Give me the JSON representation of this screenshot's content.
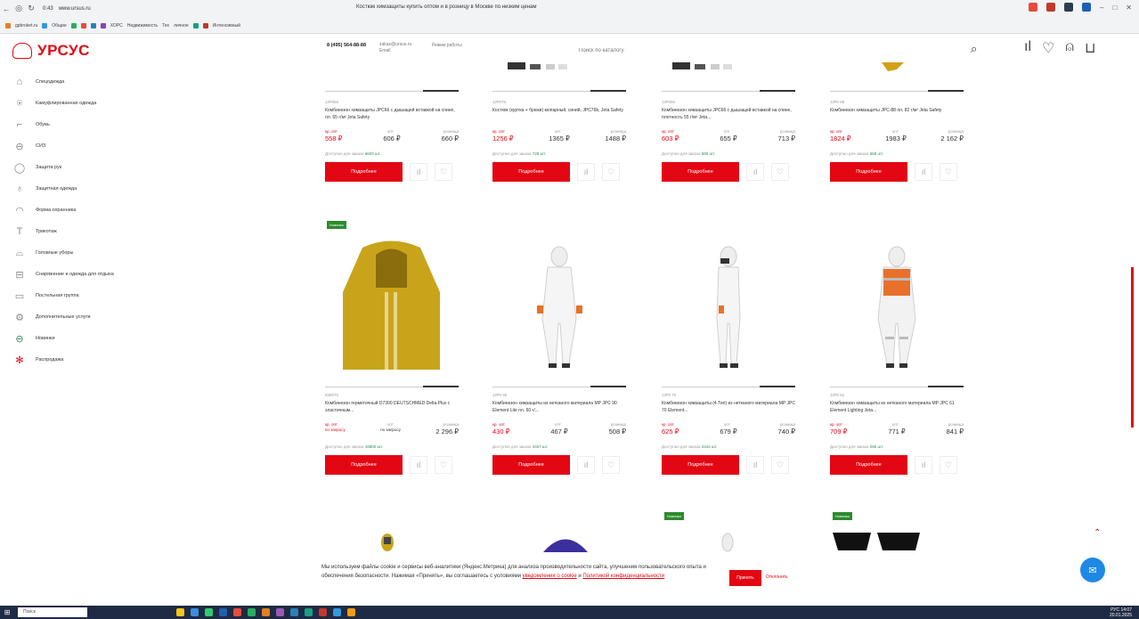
{
  "browser": {
    "url": "www.ursus.ru",
    "tab_count": "0:43",
    "page_title": "Костюм химзащиты купить оптом и в розницу в Москве по низким ценам",
    "bookmarks": [
      "gpbroket.ru",
      "Общие",
      "ХОРС",
      "Недвижимость",
      "Тех",
      "личное",
      "Интенсивный"
    ],
    "controls": {
      "minimize": "–",
      "maximize": "□",
      "close": "✕"
    }
  },
  "header": {
    "logo_text": "УРСУС",
    "phone": "8 (495) 564-88-88",
    "email": "zakaz@ursus.ru",
    "email_sub": "Email",
    "hours": "Режим работы",
    "search_placeholder": "Поиск по каталогу"
  },
  "sidebar": [
    {
      "label": "Спецодежда",
      "icon": "coat-icon"
    },
    {
      "label": "Камуфлированная одежда",
      "icon": "jacket-icon"
    },
    {
      "label": "Обувь",
      "icon": "boot-icon"
    },
    {
      "label": "СИЗ",
      "icon": "mask-icon"
    },
    {
      "label": "Защита рук",
      "icon": "glove-icon"
    },
    {
      "label": "Защитная одежда",
      "icon": "suit-icon"
    },
    {
      "label": "Форма охранника",
      "icon": "cap-icon"
    },
    {
      "label": "Трикотаж",
      "icon": "shirt-icon"
    },
    {
      "label": "Головные уборы",
      "icon": "hat-icon"
    },
    {
      "label": "Снаряжение и одежда для отдыха",
      "icon": "backpack-icon"
    },
    {
      "label": "Постельная группа",
      "icon": "bed-icon"
    },
    {
      "label": "Дополнительные услуги",
      "icon": "service-icon"
    },
    {
      "label": "Новинки",
      "icon": "new-icon"
    },
    {
      "label": "Распродажа",
      "icon": "sale-icon"
    }
  ],
  "price_labels": {
    "wholesale_large": "кр. опт",
    "wholesale": "опт",
    "retail": "розница"
  },
  "button_more": "Подробнее",
  "available_prefix": "Доступно для заказа",
  "novelty_badge": "Новинка",
  "products_row1": [
    {
      "art": "JJP056",
      "name": "Комбинезон химзащиты JPC66 с дышащей вставкой на спине, пл. 65 г/м² Jeta Safety",
      "p1": "558 ₽",
      "p2": "606 ₽",
      "p3": "660 ₽",
      "avail": "6603 шт."
    },
    {
      "art": "JJP078",
      "name": "Костюм (куртка + брюки) мопарный, синий, JPC76b, Jeta Safety",
      "p1": "1256 ₽",
      "p2": "1365 ₽",
      "p3": "1488 ₽",
      "avail": "728 шт."
    },
    {
      "art": "JJP056",
      "name": "Комбинезон химзащиты JPC66 с дышащей вставкой на спине, плотность 55 г/м² Jeta...",
      "p1": "603 ₽",
      "p2": "655 ₽",
      "p3": "713 ₽",
      "avail": "580 шт."
    },
    {
      "art": "JJP0 88",
      "name": "Комбинезон химзащиты JPC-88 пл. 82 г/м² Jeta Safety",
      "p1": "1824 ₽",
      "p2": "1983 ₽",
      "p3": "2 162 ₽",
      "avail": "668 шт."
    }
  ],
  "products_row2": [
    {
      "art": "838070",
      "name": "Комбинезон герметичный D7300 DEUTSCHMED Delta Plus с эластичным...",
      "p1": "по запросу",
      "p2": "по запросу",
      "p3": "2 296 ₽",
      "avail": "15800 шт.",
      "novelty": true
    },
    {
      "art": "JJP0 90",
      "name": "Комбинезон химзащиты из нетканого материала MP JPC 90 Element Lite пл. 60 г/...",
      "p1": "430 ₽",
      "p2": "467 ₽",
      "p3": "508 ₽",
      "avail": "3467 шт.",
      "novelty": false
    },
    {
      "art": "JJP0 70",
      "name": "Комбинезон химзащиты (4 Тип) из нетканого материала MP JPC 70 Element...",
      "p1": "625 ₽",
      "p2": "679 ₽",
      "p3": "740 ₽",
      "avail": "2344 шт.",
      "novelty": false
    },
    {
      "art": "JJP0 61",
      "name": "Комбинезон химзащиты из нетканого материала MP JPC 61 Element Lighting Jeta...",
      "p1": "709 ₽",
      "p2": "771 ₽",
      "p3": "841 ₽",
      "avail": "296 шт.",
      "novelty": false
    }
  ],
  "cookie": {
    "text": "Мы используем файлы cookie и сервисы веб-аналитики (Яндекс.Метрика) для анализа производительности сайта, улучшения пользовательского опыта и обеспечения безопасности. Нажимая «Принять», вы соглашаетесь с условиями ",
    "link1": "уведомления о cookie",
    "and": " и ",
    "link2": "Политикой конфиденциальности",
    "accept": "Принять",
    "decline": "Отклонить"
  },
  "taskbar": {
    "search": "Поиск",
    "time": "14:07",
    "date": "20.01.2025",
    "lang": "РУС"
  },
  "colors": {
    "brand_red": "#e30613",
    "novelty_green": "#2e8b2e"
  }
}
